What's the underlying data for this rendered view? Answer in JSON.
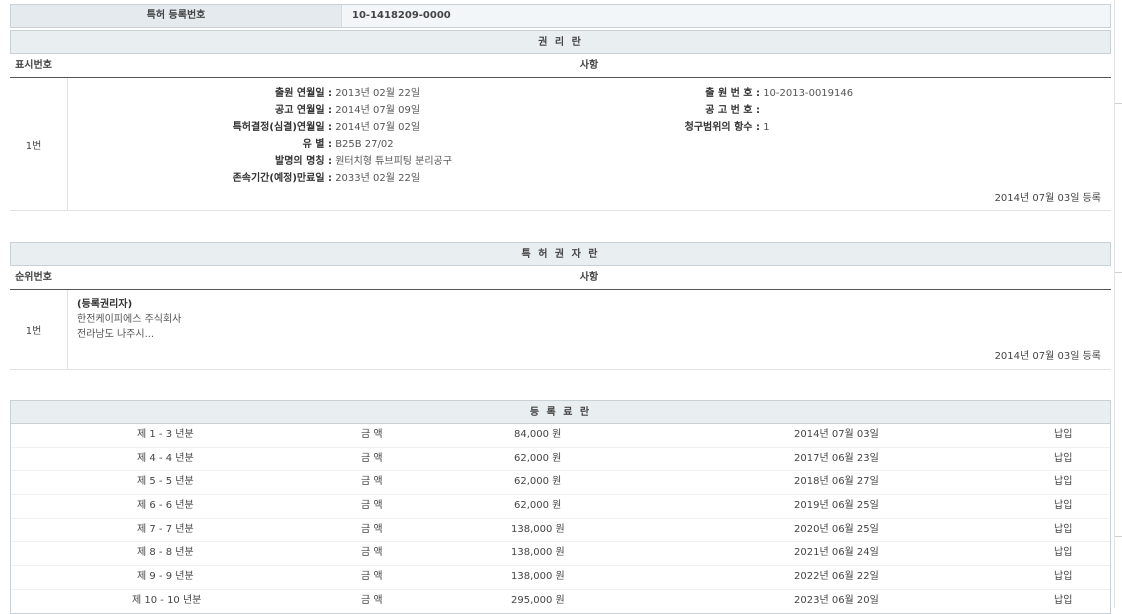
{
  "registration": {
    "label": "특허 등록번호",
    "number": "10-1418209-0000"
  },
  "rights_section": {
    "title": "권 리 란",
    "col_no": "표시번호",
    "col_matter": "사항",
    "row_no": "1번",
    "fields_left": [
      {
        "key": "출원 연월일 :",
        "value": "2013년 02월 22일"
      },
      {
        "key": "공고 연월일 :",
        "value": "2014년 07월 09일"
      },
      {
        "key": "특허결정(심결)연월일 :",
        "value": "2014년 07월 02일"
      },
      {
        "key": "유 별 :",
        "value": "B25B 27/02"
      },
      {
        "key": "발명의 명칭 :",
        "value": "원터치형 튜브피팅 분리공구"
      },
      {
        "key": "존속기간(예정)만료일 :",
        "value": "2033년 02월 22일"
      }
    ],
    "fields_right": [
      {
        "key": "출 원 번 호 :",
        "value": "10-2013-0019146"
      },
      {
        "key": "공 고 번 호 :",
        "value": ""
      },
      {
        "key": "청구범위의 항수 :",
        "value": "1"
      }
    ],
    "registered": "2014년 07월 03일 등록"
  },
  "owner_section": {
    "title": "특 허 권 자 란",
    "col_no": "순위번호",
    "col_matter": "사항",
    "row_no": "1번",
    "owner_type": "(등록권리자)",
    "owner_name": "한전케이피에스 주식회사",
    "owner_address": "전라남도 나주시...",
    "registered": "2014년 07월 03일 등록"
  },
  "fee_section": {
    "title": "등 록 료 란",
    "rows": [
      {
        "period": "제 1 - 3 년분",
        "label": "금 액",
        "amount": "84,000 원",
        "date": "2014년 07월 03일",
        "status": "납입"
      },
      {
        "period": "제 4 - 4 년분",
        "label": "금 액",
        "amount": "62,000 원",
        "date": "2017년 06월 23일",
        "status": "납입"
      },
      {
        "period": "제 5 - 5 년분",
        "label": "금 액",
        "amount": "62,000 원",
        "date": "2018년 06월 27일",
        "status": "납입"
      },
      {
        "period": "제 6 - 6 년분",
        "label": "금 액",
        "amount": "62,000 원",
        "date": "2019년 06월 25일",
        "status": "납입"
      },
      {
        "period": "제 7 - 7 년분",
        "label": "금 액",
        "amount": "138,000 원",
        "date": "2020년 06월 25일",
        "status": "납입"
      },
      {
        "period": "제 8 - 8 년분",
        "label": "금 액",
        "amount": "138,000 원",
        "date": "2021년 06월 24일",
        "status": "납입"
      },
      {
        "period": "제 9 - 9 년분",
        "label": "금 액",
        "amount": "138,000 원",
        "date": "2022년 06월 22일",
        "status": "납입"
      },
      {
        "period": "제 10 - 10 년분",
        "label": "금 액",
        "amount": "295,000 원",
        "date": "2023년 06월 20일",
        "status": "납입"
      }
    ]
  }
}
